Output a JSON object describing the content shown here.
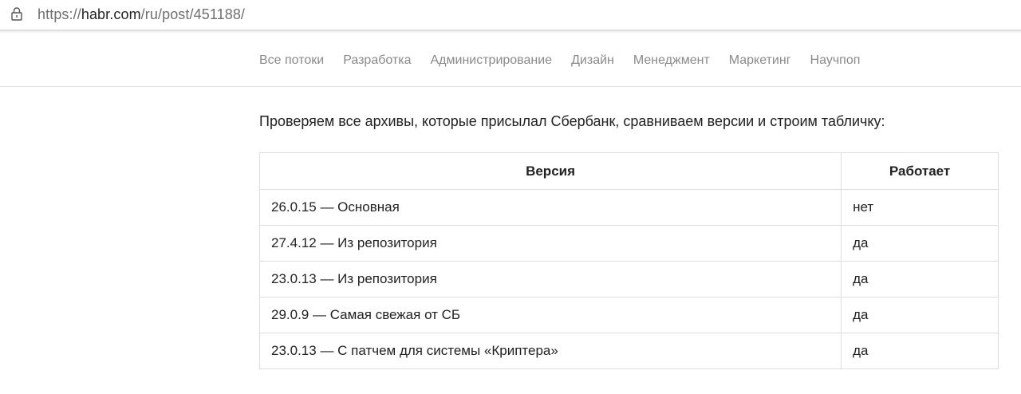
{
  "browser": {
    "url_scheme": "https://",
    "url_host": "habr.com",
    "url_path": "/ru/post/451188/",
    "lock_icon": "lock-icon"
  },
  "nav": {
    "items": [
      {
        "label": "Все потоки"
      },
      {
        "label": "Разработка"
      },
      {
        "label": "Администрирование"
      },
      {
        "label": "Дизайн"
      },
      {
        "label": "Менеджмент"
      },
      {
        "label": "Маркетинг"
      },
      {
        "label": "Научпоп"
      }
    ]
  },
  "article": {
    "intro": "Проверяем все архивы, которые присылал Сбербанк, сравниваем версии и строим табличку:",
    "table": {
      "headers": [
        "Версия",
        "Работает"
      ],
      "rows": [
        [
          "26.0.15 — Основная",
          "нет"
        ],
        [
          "27.4.12 — Из репозитория",
          "да"
        ],
        [
          "23.0.13 — Из репозитория",
          "да"
        ],
        [
          "29.0.9 — Самая свежая от СБ",
          "да"
        ],
        [
          "23.0.13 — С патчем для системы «Криптера»",
          "да"
        ]
      ]
    }
  },
  "colors": {
    "nav_text": "#8a8a8a",
    "text": "#222222",
    "url_muted": "#6f6f6f",
    "border": "#dddddd"
  }
}
